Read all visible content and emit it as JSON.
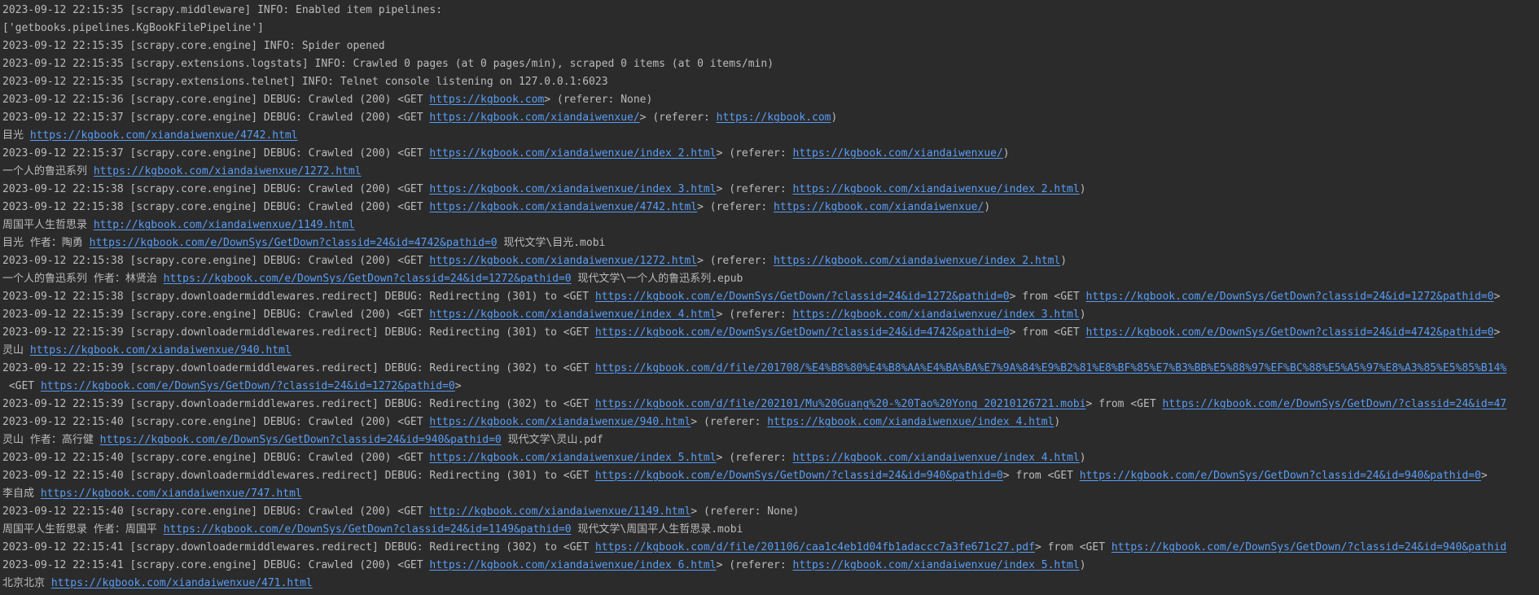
{
  "colors": {
    "background": "#2b2b2b",
    "text": "#bbbbbb",
    "link": "#589df6"
  },
  "console_lines": [
    [
      {
        "t": "2023-09-12 22:15:35 [scrapy.middleware] INFO: Enabled item pipelines:"
      }
    ],
    [
      {
        "t": "['getbooks.pipelines.KgBookFilePipeline']"
      }
    ],
    [
      {
        "t": "2023-09-12 22:15:35 [scrapy.core.engine] INFO: Spider opened"
      }
    ],
    [
      {
        "t": "2023-09-12 22:15:35 [scrapy.extensions.logstats] INFO: Crawled 0 pages (at 0 pages/min), scraped 0 items (at 0 items/min)"
      }
    ],
    [
      {
        "t": "2023-09-12 22:15:35 [scrapy.extensions.telnet] INFO: Telnet console listening on 127.0.0.1:6023"
      }
    ],
    [
      {
        "t": "2023-09-12 22:15:36 [scrapy.core.engine] DEBUG: Crawled (200) <GET "
      },
      {
        "t": "https://kgbook.com",
        "link": true
      },
      {
        "t": "> (referer: None)"
      }
    ],
    [
      {
        "t": "2023-09-12 22:15:37 [scrapy.core.engine] DEBUG: Crawled (200) <GET "
      },
      {
        "t": "https://kgbook.com/xiandaiwenxue/",
        "link": true
      },
      {
        "t": "> (referer: "
      },
      {
        "t": "https://kgbook.com",
        "link": true
      },
      {
        "t": ")"
      }
    ],
    [
      {
        "t": "目光 "
      },
      {
        "t": "https://kgbook.com/xiandaiwenxue/4742.html",
        "link": true
      }
    ],
    [
      {
        "t": "2023-09-12 22:15:37 [scrapy.core.engine] DEBUG: Crawled (200) <GET "
      },
      {
        "t": "https://kgbook.com/xiandaiwenxue/index_2.html",
        "link": true
      },
      {
        "t": "> (referer: "
      },
      {
        "t": "https://kgbook.com/xiandaiwenxue/",
        "link": true
      },
      {
        "t": ")"
      }
    ],
    [
      {
        "t": "一个人的鲁迅系列 "
      },
      {
        "t": "https://kgbook.com/xiandaiwenxue/1272.html",
        "link": true
      }
    ],
    [
      {
        "t": "2023-09-12 22:15:38 [scrapy.core.engine] DEBUG: Crawled (200) <GET "
      },
      {
        "t": "https://kgbook.com/xiandaiwenxue/index_3.html",
        "link": true
      },
      {
        "t": "> (referer: "
      },
      {
        "t": "https://kgbook.com/xiandaiwenxue/index_2.html",
        "link": true
      },
      {
        "t": ")"
      }
    ],
    [
      {
        "t": "2023-09-12 22:15:38 [scrapy.core.engine] DEBUG: Crawled (200) <GET "
      },
      {
        "t": "https://kgbook.com/xiandaiwenxue/4742.html",
        "link": true
      },
      {
        "t": "> (referer: "
      },
      {
        "t": "https://kgbook.com/xiandaiwenxue/",
        "link": true
      },
      {
        "t": ")"
      }
    ],
    [
      {
        "t": "周国平人生哲思录 "
      },
      {
        "t": "http://kgbook.com/xiandaiwenxue/1149.html",
        "link": true
      }
    ],
    [
      {
        "t": "目光 作者：陶勇 "
      },
      {
        "t": "https://kgbook.com/e/DownSys/GetDown?classid=24&id=4742&pathid=0",
        "link": true
      },
      {
        "t": " 现代文学\\目光.mobi"
      }
    ],
    [
      {
        "t": "2023-09-12 22:15:38 [scrapy.core.engine] DEBUG: Crawled (200) <GET "
      },
      {
        "t": "https://kgbook.com/xiandaiwenxue/1272.html",
        "link": true
      },
      {
        "t": "> (referer: "
      },
      {
        "t": "https://kgbook.com/xiandaiwenxue/index_2.html",
        "link": true
      },
      {
        "t": ")"
      }
    ],
    [
      {
        "t": "一个人的鲁迅系列 作者：林贤治 "
      },
      {
        "t": "https://kgbook.com/e/DownSys/GetDown?classid=24&id=1272&pathid=0",
        "link": true
      },
      {
        "t": " 现代文学\\一个人的鲁迅系列.epub"
      }
    ],
    [
      {
        "t": "2023-09-12 22:15:38 [scrapy.downloadermiddlewares.redirect] DEBUG: Redirecting (301) to <GET "
      },
      {
        "t": "https://kgbook.com/e/DownSys/GetDown/?classid=24&id=1272&pathid=0",
        "link": true
      },
      {
        "t": "> from <GET "
      },
      {
        "t": "https://kgbook.com/e/DownSys/GetDown?classid=24&id=1272&pathid=0",
        "link": true
      },
      {
        "t": ">"
      }
    ],
    [
      {
        "t": "2023-09-12 22:15:39 [scrapy.core.engine] DEBUG: Crawled (200) <GET "
      },
      {
        "t": "https://kgbook.com/xiandaiwenxue/index_4.html",
        "link": true
      },
      {
        "t": "> (referer: "
      },
      {
        "t": "https://kgbook.com/xiandaiwenxue/index_3.html",
        "link": true
      },
      {
        "t": ")"
      }
    ],
    [
      {
        "t": "2023-09-12 22:15:39 [scrapy.downloadermiddlewares.redirect] DEBUG: Redirecting (301) to <GET "
      },
      {
        "t": "https://kgbook.com/e/DownSys/GetDown/?classid=24&id=4742&pathid=0",
        "link": true
      },
      {
        "t": "> from <GET "
      },
      {
        "t": "https://kgbook.com/e/DownSys/GetDown?classid=24&id=4742&pathid=0",
        "link": true
      },
      {
        "t": ">"
      }
    ],
    [
      {
        "t": "灵山 "
      },
      {
        "t": "https://kgbook.com/xiandaiwenxue/940.html",
        "link": true
      }
    ],
    [
      {
        "t": "2023-09-12 22:15:39 [scrapy.downloadermiddlewares.redirect] DEBUG: Redirecting (302) to <GET "
      },
      {
        "t": "https://kgbook.com/d/file/201708/%E4%B8%80%E4%B8%AA%E4%BA%BA%E7%9A%84%E9%B2%81%E8%BF%85%E7%B3%BB%E5%88%97%EF%BC%88%E5%A5%97%E8%A3%85%E5%85%B14%",
        "link": true
      }
    ],
    [
      {
        "t": " <GET "
      },
      {
        "t": "https://kgbook.com/e/DownSys/GetDown/?classid=24&id=1272&pathid=0",
        "link": true
      },
      {
        "t": ">"
      }
    ],
    [
      {
        "t": "2023-09-12 22:15:39 [scrapy.downloadermiddlewares.redirect] DEBUG: Redirecting (302) to <GET "
      },
      {
        "t": "https://kgbook.com/d/file/202101/Mu%20Guang%20-%20Tao%20Yong_20210126721.mobi",
        "link": true
      },
      {
        "t": "> from <GET "
      },
      {
        "t": "https://kgbook.com/e/DownSys/GetDown/?classid=24&id=47",
        "link": true
      }
    ],
    [
      {
        "t": "2023-09-12 22:15:40 [scrapy.core.engine] DEBUG: Crawled (200) <GET "
      },
      {
        "t": "https://kgbook.com/xiandaiwenxue/940.html",
        "link": true
      },
      {
        "t": "> (referer: "
      },
      {
        "t": "https://kgbook.com/xiandaiwenxue/index_4.html",
        "link": true
      },
      {
        "t": ")"
      }
    ],
    [
      {
        "t": "灵山 作者：高行健 "
      },
      {
        "t": "https://kgbook.com/e/DownSys/GetDown?classid=24&id=940&pathid=0",
        "link": true
      },
      {
        "t": " 现代文学\\灵山.pdf"
      }
    ],
    [
      {
        "t": "2023-09-12 22:15:40 [scrapy.core.engine] DEBUG: Crawled (200) <GET "
      },
      {
        "t": "https://kgbook.com/xiandaiwenxue/index_5.html",
        "link": true
      },
      {
        "t": "> (referer: "
      },
      {
        "t": "https://kgbook.com/xiandaiwenxue/index_4.html",
        "link": true
      },
      {
        "t": ")"
      }
    ],
    [
      {
        "t": "2023-09-12 22:15:40 [scrapy.downloadermiddlewares.redirect] DEBUG: Redirecting (301) to <GET "
      },
      {
        "t": "https://kgbook.com/e/DownSys/GetDown/?classid=24&id=940&pathid=0",
        "link": true
      },
      {
        "t": "> from <GET "
      },
      {
        "t": "https://kgbook.com/e/DownSys/GetDown?classid=24&id=940&pathid=0",
        "link": true
      },
      {
        "t": ">"
      }
    ],
    [
      {
        "t": "李自成 "
      },
      {
        "t": "https://kgbook.com/xiandaiwenxue/747.html",
        "link": true
      }
    ],
    [
      {
        "t": "2023-09-12 22:15:40 [scrapy.core.engine] DEBUG: Crawled (200) <GET "
      },
      {
        "t": "http://kgbook.com/xiandaiwenxue/1149.html",
        "link": true
      },
      {
        "t": "> (referer: None)"
      }
    ],
    [
      {
        "t": "周国平人生哲思录 作者：周国平 "
      },
      {
        "t": "https://kgbook.com/e/DownSys/GetDown?classid=24&id=1149&pathid=0",
        "link": true
      },
      {
        "t": " 现代文学\\周国平人生哲思录.mobi"
      }
    ],
    [
      {
        "t": "2023-09-12 22:15:41 [scrapy.downloadermiddlewares.redirect] DEBUG: Redirecting (302) to <GET "
      },
      {
        "t": "https://kgbook.com/d/file/201106/caa1c4eb1d04fb1adaccc7a3fe671c27.pdf",
        "link": true
      },
      {
        "t": "> from <GET "
      },
      {
        "t": "https://kgbook.com/e/DownSys/GetDown/?classid=24&id=940&pathid",
        "link": true
      }
    ],
    [
      {
        "t": "2023-09-12 22:15:41 [scrapy.core.engine] DEBUG: Crawled (200) <GET "
      },
      {
        "t": "https://kgbook.com/xiandaiwenxue/index_6.html",
        "link": true
      },
      {
        "t": "> (referer: "
      },
      {
        "t": "https://kgbook.com/xiandaiwenxue/index_5.html",
        "link": true
      },
      {
        "t": ")"
      }
    ],
    [
      {
        "t": "北京北京 "
      },
      {
        "t": "https://kgbook.com/xiandaiwenxue/471.html",
        "link": true
      }
    ]
  ]
}
